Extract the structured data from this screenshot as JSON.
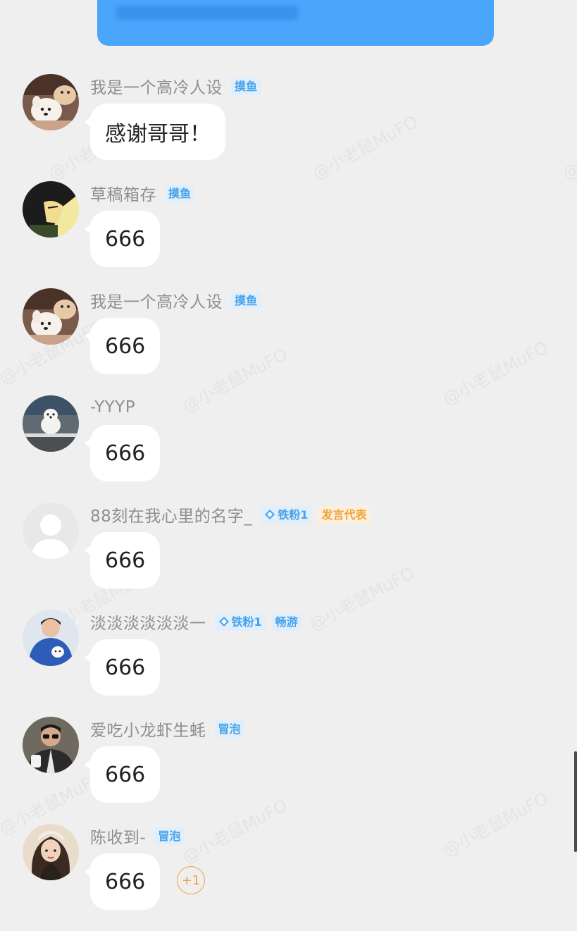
{
  "watermark": "@小老鼠MuFO",
  "messages": [
    {
      "name": "我是一个高冷人设",
      "avatar_icon": "dog-with-plush-avatar",
      "badges": [
        {
          "label": "摸鱼",
          "color": "blue",
          "icon": null
        }
      ],
      "text": "感谢哥哥！"
    },
    {
      "name": "草稿箱存",
      "avatar_icon": "anime-character-avatar",
      "badges": [
        {
          "label": "摸鱼",
          "color": "blue",
          "icon": null
        }
      ],
      "text": "666"
    },
    {
      "name": "我是一个高冷人设",
      "avatar_icon": "dog-with-plush-avatar",
      "badges": [
        {
          "label": "摸鱼",
          "color": "blue",
          "icon": null
        }
      ],
      "text": "666"
    },
    {
      "name": "-YYYP",
      "avatar_icon": "white-dog-photo-avatar",
      "badges": [],
      "text": "666"
    },
    {
      "name": "88刻在我心里的名字_",
      "avatar_icon": "default-user-avatar",
      "badges": [
        {
          "label": "铁粉1",
          "color": "blue",
          "icon": "diamond-icon"
        },
        {
          "label": "发言代表",
          "color": "orange",
          "icon": null
        }
      ],
      "text": "666"
    },
    {
      "name": "淡淡淡淡淡淡一",
      "avatar_icon": "person-blue-hoodie-avatar",
      "badges": [
        {
          "label": "铁粉1",
          "color": "blue",
          "icon": "diamond-icon"
        },
        {
          "label": "畅游",
          "color": "blue",
          "icon": null
        }
      ],
      "text": "666"
    },
    {
      "name": "爱吃小龙虾生蚝",
      "avatar_icon": "person-sunglasses-avatar",
      "badges": [
        {
          "label": "冒泡",
          "color": "blue",
          "icon": null
        }
      ],
      "text": "666"
    },
    {
      "name": "陈收到-",
      "avatar_icon": "illustrated-woman-avatar",
      "badges": [
        {
          "label": "冒泡",
          "color": "blue",
          "icon": null
        }
      ],
      "text": "666"
    }
  ],
  "reaction": {
    "label": "+1"
  },
  "colors": {
    "background": "#efefef",
    "self_bubble": "#4aa6fb",
    "badge_blue_text": "#46a3ea",
    "badge_blue_bg": "#e1eefb",
    "badge_orange_text": "#f0a23a",
    "badge_orange_bg": "#fdefdc",
    "name_text": "#8f8f8f"
  }
}
